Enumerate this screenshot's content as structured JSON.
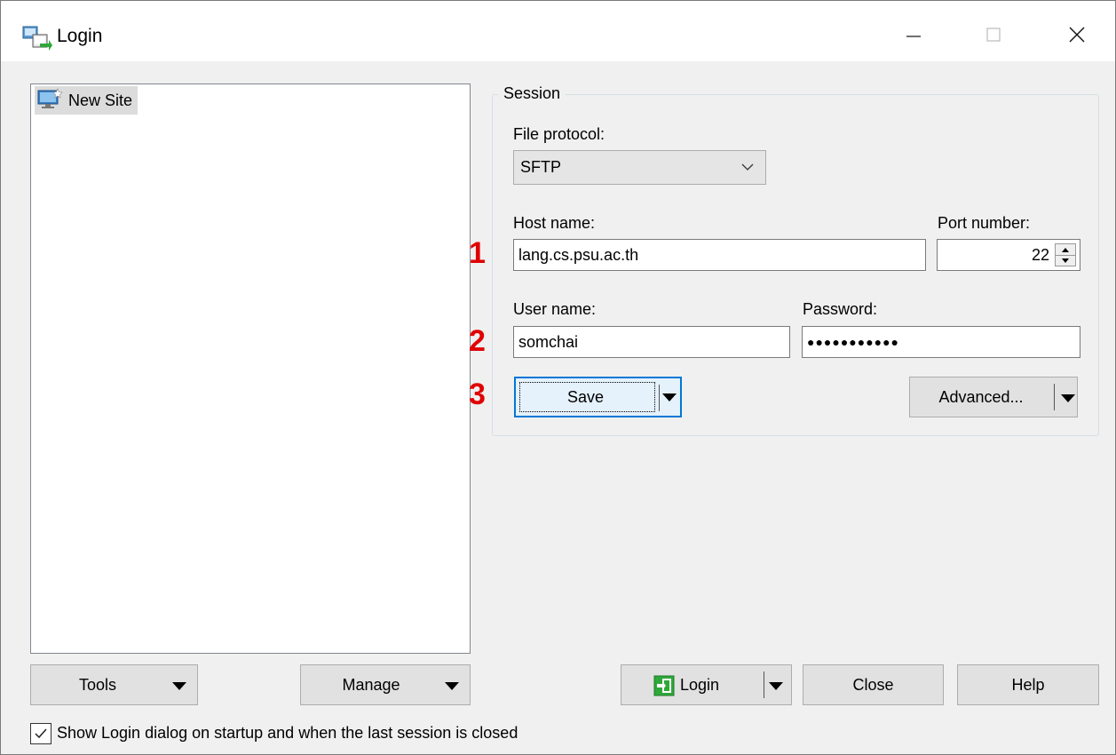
{
  "window": {
    "title": "Login",
    "minimize_glyph": "—",
    "maximize_glyph": "☐",
    "close_glyph": "✕"
  },
  "site_tree": {
    "items": [
      {
        "label": "New Site",
        "icon": "new-site-monitor-icon"
      }
    ]
  },
  "session": {
    "legend": "Session",
    "file_protocol_label": "File protocol:",
    "file_protocol_value": "SFTP",
    "host_label": "Host name:",
    "host_value": "lang.cs.psu.ac.th",
    "port_label": "Port number:",
    "port_value": "22",
    "user_label": "User name:",
    "user_value": "somchai",
    "password_label": "Password:",
    "password_value": "●●●●●●●●●●●",
    "save_label": "Save",
    "advanced_label": "Advanced..."
  },
  "annotations": {
    "step1": "1",
    "step2": "2",
    "step3": "3",
    "color": "#e10000"
  },
  "footer": {
    "tools_label": "Tools",
    "manage_label": "Manage",
    "login_label": "Login",
    "close_label": "Close",
    "help_label": "Help",
    "show_login_label": "Show Login dialog on startup and when the last session is closed",
    "show_login_checked": true
  },
  "colors": {
    "focus_border": "#0078d7",
    "login_icon_green": "#2fa83a"
  }
}
